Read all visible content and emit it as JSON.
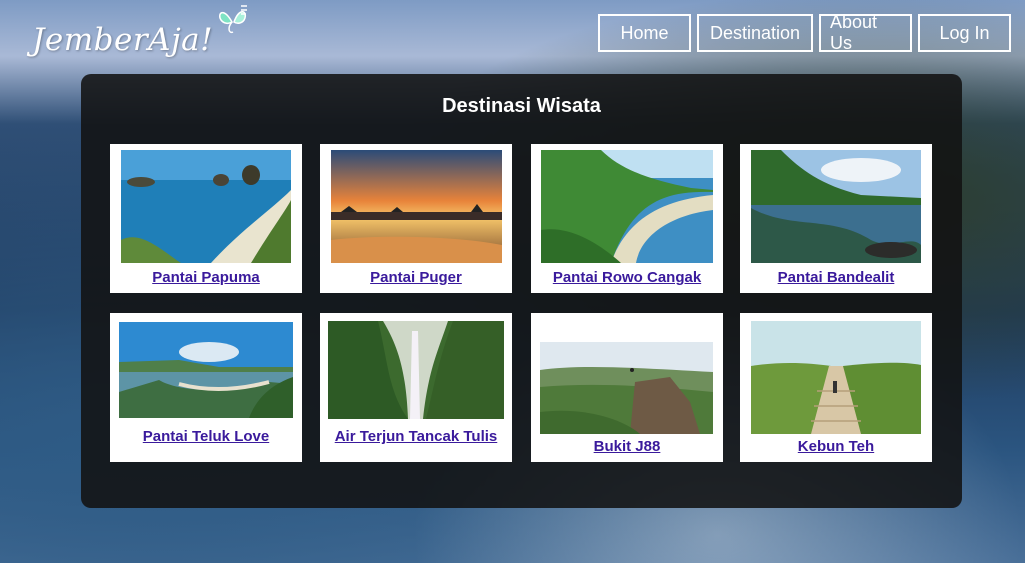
{
  "logo": {
    "text": "JemberAja!"
  },
  "nav": {
    "home": "Home",
    "destination": "Destination",
    "about": "About Us",
    "login": "Log In"
  },
  "main": {
    "title": "Destinasi Wisata",
    "destinations": [
      {
        "name": "Pantai Papuma"
      },
      {
        "name": "Pantai Puger"
      },
      {
        "name": "Pantai Rowo Cangak"
      },
      {
        "name": "Pantai Bandealit"
      },
      {
        "name": "Pantai Teluk Love"
      },
      {
        "name": "Air Terjun Tancak Tulis"
      },
      {
        "name": "Bukit J88"
      },
      {
        "name": "Kebun Teh"
      }
    ]
  }
}
